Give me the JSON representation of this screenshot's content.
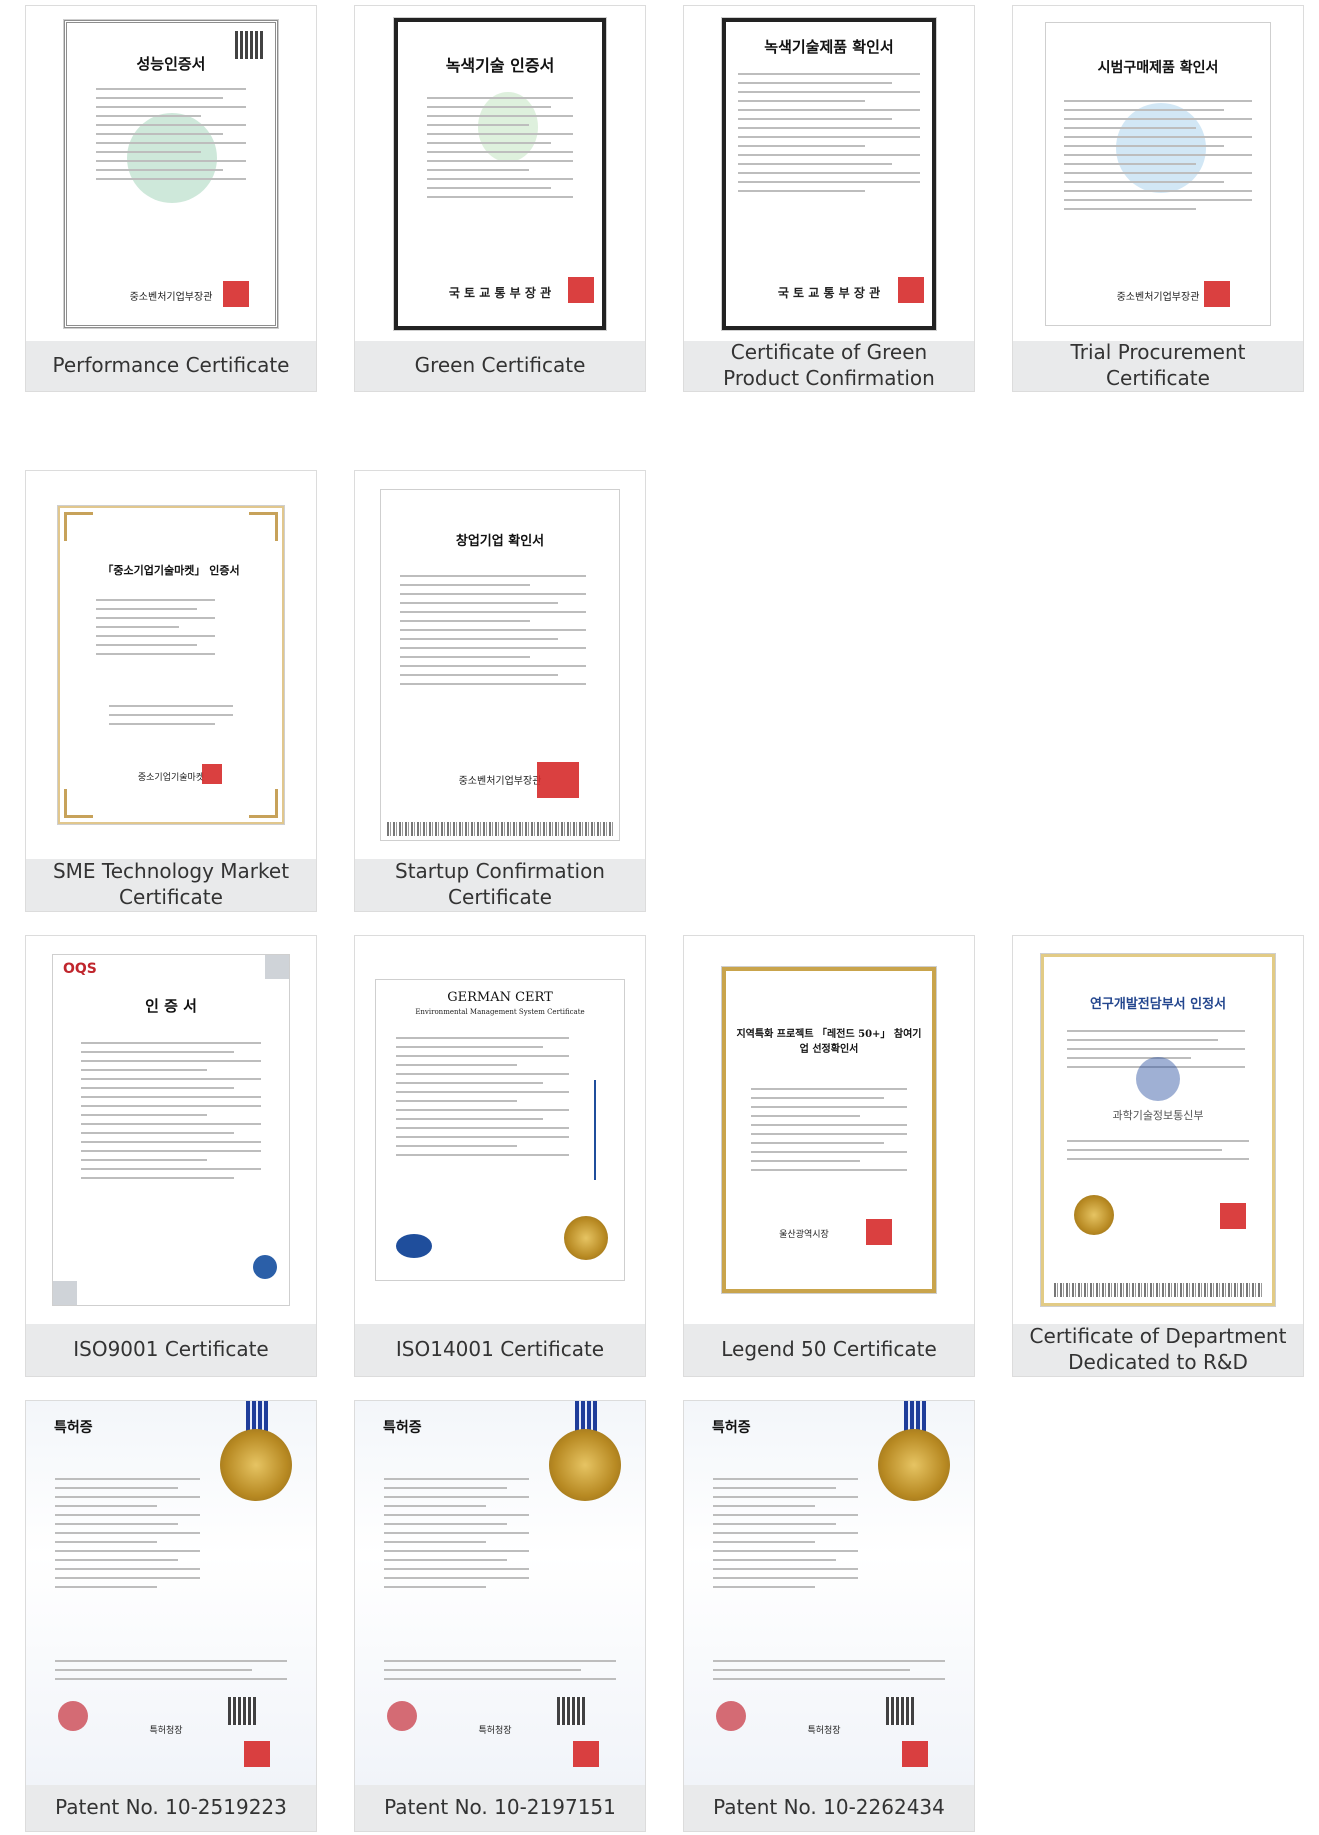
{
  "certificates": [
    {
      "caption": "Performance Certificate",
      "doc_title": "성능인증서",
      "doc_issuer": "중소벤처기업부장관"
    },
    {
      "caption": "Green Certificate",
      "doc_title": "녹색기술 인증서",
      "doc_issuer": "국 토 교 통 부 장 관"
    },
    {
      "caption": "Certificate of Green Product Confirmation",
      "doc_title": "녹색기술제품 확인서",
      "doc_issuer": "국 토 교 통 부 장 관"
    },
    {
      "caption": "Trial Procurement Certificate",
      "doc_title": "시범구매제품 확인서",
      "doc_issuer": "중소벤처기업부장관"
    },
    {
      "caption": "SME Technology Market Certificate",
      "doc_title": "「중소기업기술마켓」 인증서",
      "doc_issuer": "중소기업기술마켓"
    },
    {
      "caption": "Startup Confirmation Certificate",
      "doc_title": "창업기업 확인서",
      "doc_issuer": "중소벤처기업부장관"
    },
    {
      "caption": "ISO9001 Certificate",
      "doc_title": "인 증 서",
      "doc_issuer": "OQS"
    },
    {
      "caption": "ISO14001 Certificate",
      "doc_title": "GERMAN CERT",
      "doc_issuer": "Environmental Management System Certificate"
    },
    {
      "caption": "Legend 50 Certificate",
      "doc_title": "지역특화 프로젝트 「레전드 50+」 참여기업 선정확인서",
      "doc_issuer": "울산광역시장"
    },
    {
      "caption": "Certificate of Department Dedicated to R&D",
      "doc_title": "연구개발전담부서 인정서",
      "doc_issuer": "과학기술정보통신부"
    },
    {
      "caption": "Patent No. 10-2519223",
      "doc_title": "특허증",
      "doc_issuer": "특허청장"
    },
    {
      "caption": "Patent No. 10-2197151",
      "doc_title": "특허증",
      "doc_issuer": "특허청장"
    },
    {
      "caption": "Patent No. 10-2262434",
      "doc_title": "특허증",
      "doc_issuer": "특허청장"
    }
  ],
  "colors": {
    "caption_bg": "#e9eaeb",
    "caption_text": "#333333",
    "seal_red": "#d62b2b",
    "gold": "#c9a44c"
  }
}
